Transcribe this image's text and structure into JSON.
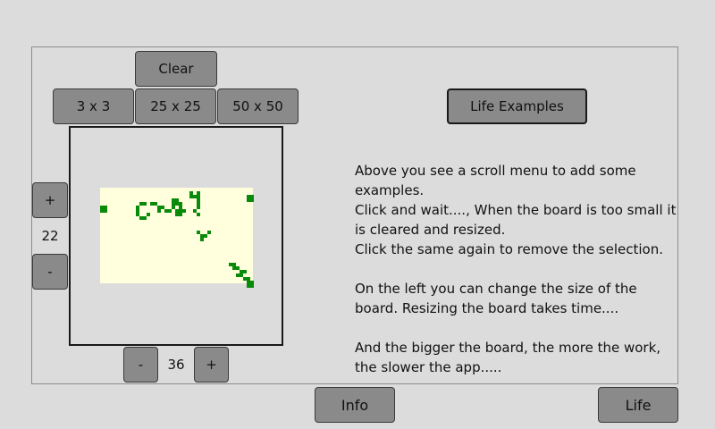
{
  "toolbar": {
    "clear_label": "Clear",
    "size_3_label": "3 x 3",
    "size_25_label": "25 x 25",
    "size_50_label": "50 x 50"
  },
  "examples_button": "Life Examples",
  "rows": {
    "plus_label": "+",
    "value": "22",
    "minus_label": "-"
  },
  "cols": {
    "minus_label": "-",
    "value": "36",
    "plus_label": "+"
  },
  "description": {
    "line1": "Above you see a scroll menu to add some examples.",
    "line2": "Click and wait...., When the board is too small it is cleared and resized.",
    "line3": "Click the same again to remove the selection.",
    "line4": "On the left you can change the size of the board. Resizing the board takes time....",
    "line5": "And the bigger the board, the more the work, the slower the app....."
  },
  "footer": {
    "info_label": "Info",
    "life_label": "Life"
  },
  "colors": {
    "background": "#dcdcdc",
    "button": "#8a8a8a",
    "board_field": "#ffffde",
    "cell_alive": "#0a8a0a"
  }
}
